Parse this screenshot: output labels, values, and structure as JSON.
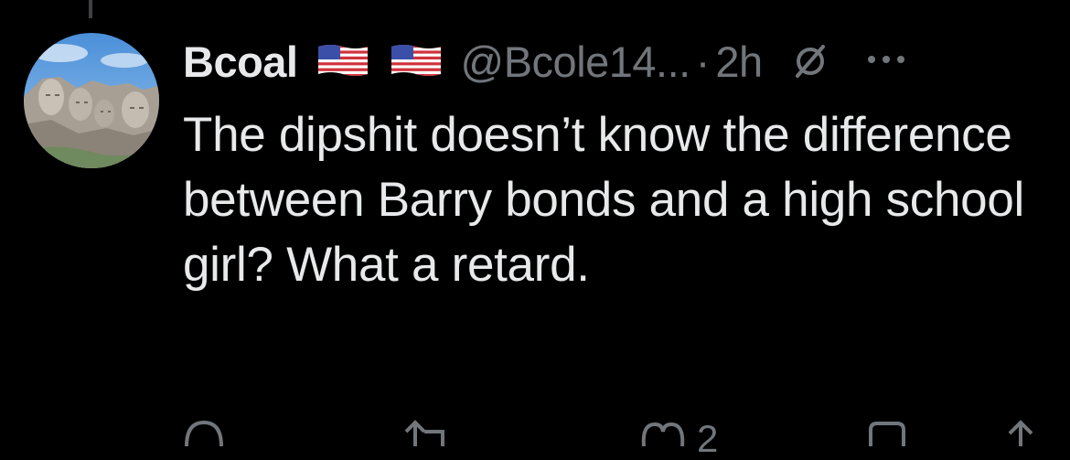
{
  "tweet": {
    "display_name": "Bcoal",
    "flag_emojis": [
      "🇺🇸",
      "🇺🇸"
    ],
    "handle": "@Bcole14...",
    "separator": "·",
    "time": "2h",
    "text": "The dipshit doesn’t know the difference between Barry bonds and a high school girl? What a retard.",
    "avatar_icon": "mount-rushmore-avatar",
    "header_icons": [
      "no-entry-slash-icon",
      "more-options-icon"
    ]
  },
  "actions": {
    "reply": {
      "icon": "reply-bubble-icon",
      "count": ""
    },
    "repost": {
      "icon": "repost-icon",
      "count": ""
    },
    "like": {
      "icon": "heart-icon",
      "count": "2"
    },
    "bookmark": {
      "icon": "bookmark-icon",
      "count": ""
    },
    "share": {
      "icon": "share-icon",
      "count": ""
    }
  },
  "colors": {
    "background": "#000000",
    "primary_text": "#e7e9ea",
    "secondary_text": "#71767b"
  }
}
